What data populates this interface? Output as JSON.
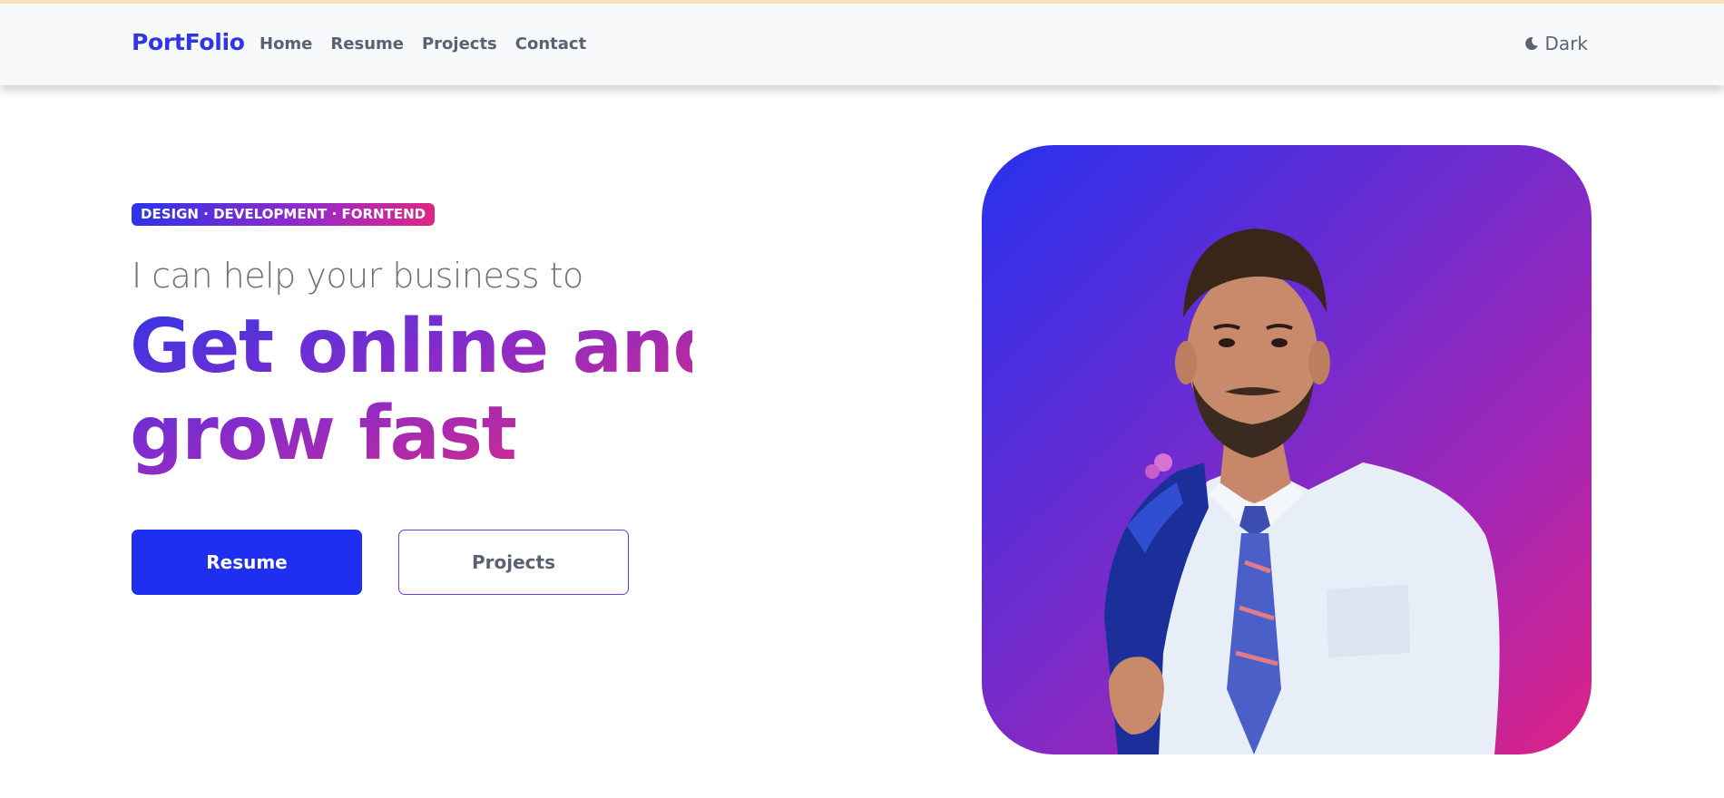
{
  "navbar": {
    "brand": "PortFolio",
    "links": [
      "Home",
      "Resume",
      "Projects",
      "Contact"
    ],
    "theme_toggle_label": "Dark",
    "theme_toggle_icon": "moon-icon"
  },
  "hero": {
    "tagline": "DESIGN · DEVELOPMENT · FORNTEND",
    "intro": "I can help your business to",
    "headline_line1": "Get online and",
    "headline_line2": "grow fast",
    "primary_button": "Resume",
    "secondary_button": "Projects"
  },
  "colors": {
    "brand": "#2f36e6",
    "primary_button": "#1f2ff0",
    "gradient_start": "#2830ee",
    "gradient_end": "#dd2286",
    "top_strip": "#fde3bd"
  }
}
